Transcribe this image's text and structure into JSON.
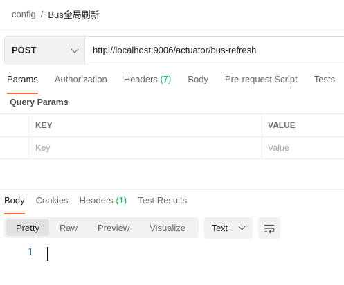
{
  "breadcrumb": {
    "parent": "config",
    "separator": "/",
    "current": "Bus全局刷新"
  },
  "request": {
    "method": "POST",
    "url": "http://localhost:9006/actuator/bus-refresh"
  },
  "request_tabs": [
    {
      "label": "Params",
      "count": ""
    },
    {
      "label": "Authorization",
      "count": ""
    },
    {
      "label": "Headers",
      "count": "(7)"
    },
    {
      "label": "Body",
      "count": ""
    },
    {
      "label": "Pre-request Script",
      "count": ""
    },
    {
      "label": "Tests",
      "count": ""
    }
  ],
  "query_params": {
    "title": "Query Params",
    "columns": {
      "key": "KEY",
      "value": "VALUE"
    },
    "placeholders": {
      "key": "Key",
      "value": "Value"
    }
  },
  "response_tabs": [
    {
      "label": "Body",
      "count": ""
    },
    {
      "label": "Cookies",
      "count": ""
    },
    {
      "label": "Headers",
      "count": "(1)"
    },
    {
      "label": "Test Results",
      "count": ""
    }
  ],
  "view_modes": [
    "Pretty",
    "Raw",
    "Preview",
    "Visualize"
  ],
  "format": "Text",
  "editor": {
    "line_numbers": [
      "1"
    ]
  },
  "colors": {
    "accent": "#ff6c37",
    "count": "#0cbb52",
    "line_number": "#2f6f9e"
  }
}
